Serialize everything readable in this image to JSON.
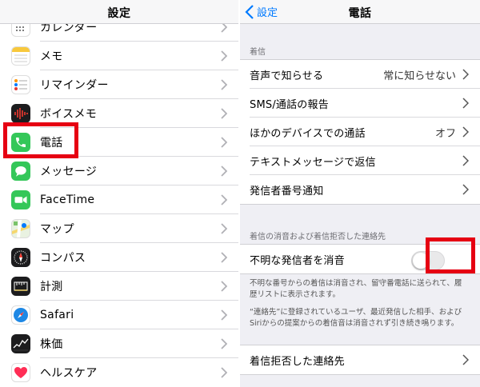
{
  "left": {
    "title": "設定",
    "items": [
      {
        "label": "カレンダー",
        "icon": "calendar-icon"
      },
      {
        "label": "メモ",
        "icon": "notes-icon"
      },
      {
        "label": "リマインダー",
        "icon": "reminders-icon"
      },
      {
        "label": "ボイスメモ",
        "icon": "voice-memos-icon"
      },
      {
        "label": "電話",
        "icon": "phone-icon"
      },
      {
        "label": "メッセージ",
        "icon": "messages-icon"
      },
      {
        "label": "FaceTime",
        "icon": "facetime-icon"
      },
      {
        "label": "マップ",
        "icon": "maps-icon"
      },
      {
        "label": "コンパス",
        "icon": "compass-icon"
      },
      {
        "label": "計測",
        "icon": "measure-icon"
      },
      {
        "label": "Safari",
        "icon": "safari-icon"
      },
      {
        "label": "株価",
        "icon": "stocks-icon"
      },
      {
        "label": "ヘルスケア",
        "icon": "health-icon"
      }
    ]
  },
  "right": {
    "back_label": "設定",
    "title": "電話",
    "section_incoming": "着信",
    "incoming_rows": [
      {
        "label": "音声で知らせる",
        "value": "常に知らせない"
      },
      {
        "label": "SMS/通話の報告",
        "value": ""
      },
      {
        "label": "ほかのデバイスでの通話",
        "value": "オフ"
      },
      {
        "label": "テキストメッセージで返信",
        "value": ""
      },
      {
        "label": "発信者番号通知",
        "value": ""
      }
    ],
    "section_silence": "着信の消音および着信拒否した連絡先",
    "silence_row": {
      "label": "不明な発信者を消音",
      "toggle_on": false
    },
    "note_1": "不明な番号からの着信は消音され、留守番電話に送られて、履歴リストに表示されます。",
    "note_2": "“連絡先”に登録されているユーザ、最近発信した相手、およびSiriからの提案からの着信音は消音されず引き続き鳴ります。",
    "blocked_row": {
      "label": "着信拒否した連絡先"
    }
  },
  "colors": {
    "highlight": "#e60012",
    "ios_blue": "#007aff",
    "phone_green": "#34c759",
    "group_background": "#efeff4"
  }
}
